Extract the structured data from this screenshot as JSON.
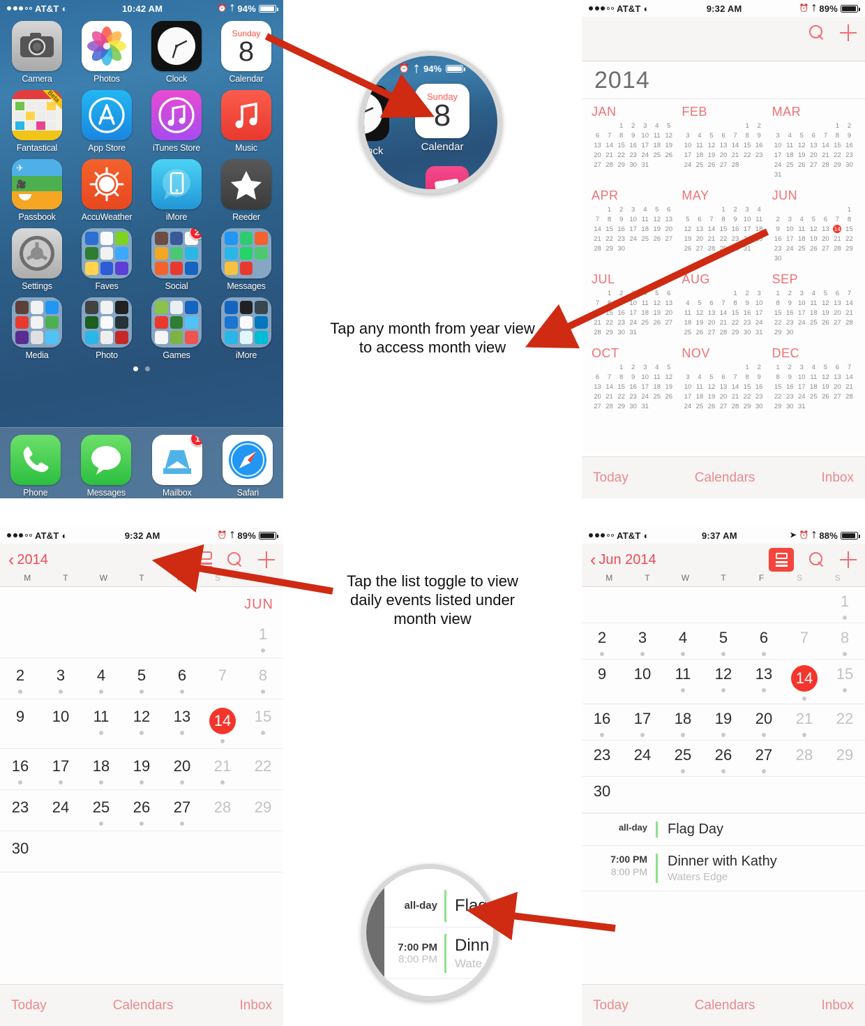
{
  "homescreen": {
    "status": {
      "carrier": "AT&T",
      "time": "10:42 AM",
      "battery": "94%",
      "signal_dots": [
        1,
        1,
        1,
        0,
        0
      ]
    },
    "rows": [
      [
        {
          "label": "Camera",
          "icon": "camera-icon"
        },
        {
          "label": "Photos",
          "icon": "photos-icon"
        },
        {
          "label": "Clock",
          "icon": "clock-icon"
        },
        {
          "label": "Calendar",
          "icon": "calendar-icon",
          "weekday": "Sunday",
          "day": "8"
        }
      ],
      [
        {
          "label": "Fantastical",
          "icon": "fantastical-icon",
          "ribbon": "Beta"
        },
        {
          "label": "App Store",
          "icon": "app-store-icon"
        },
        {
          "label": "iTunes Store",
          "icon": "itunes-store-icon"
        },
        {
          "label": "Music",
          "icon": "music-icon"
        }
      ],
      [
        {
          "label": "Passbook",
          "icon": "passbook-icon"
        },
        {
          "label": "AccuWeather",
          "icon": "accuweather-icon"
        },
        {
          "label": "iMore",
          "icon": "imore-icon"
        },
        {
          "label": "Reeder",
          "icon": "reeder-icon"
        }
      ],
      [
        {
          "label": "Settings",
          "icon": "settings-gear-icon"
        },
        {
          "label": "Faves",
          "icon": "folder-icon"
        },
        {
          "label": "Social",
          "icon": "folder-icon",
          "badge": "2"
        },
        {
          "label": "Messages",
          "icon": "folder-icon"
        }
      ],
      [
        {
          "label": "Media",
          "icon": "folder-icon"
        },
        {
          "label": "Photo",
          "icon": "folder-icon"
        },
        {
          "label": "Games",
          "icon": "folder-icon"
        },
        {
          "label": "iMore",
          "icon": "folder-icon"
        }
      ]
    ],
    "dock": [
      {
        "label": "Phone",
        "icon": "phone-icon"
      },
      {
        "label": "Messages",
        "icon": "messages-icon"
      },
      {
        "label": "Mailbox",
        "icon": "mailbox-icon",
        "badge": "1"
      },
      {
        "label": "Safari",
        "icon": "safari-compass-icon"
      }
    ],
    "page_dots": 2,
    "active_page": 0
  },
  "magnifier_home": {
    "battery": "94%",
    "weekday": "Sunday",
    "day": "8",
    "calendar_label": "Calendar",
    "clock_label": "ock"
  },
  "yearview": {
    "status": {
      "carrier": "AT&T",
      "time": "9:32 AM",
      "battery": "89%",
      "signal_dots": [
        1,
        1,
        1,
        0,
        0
      ]
    },
    "search_icon": "search-icon",
    "add_icon": "plus-icon",
    "year": "2014",
    "months": [
      {
        "name": "JAN",
        "lead": 2,
        "days": 31,
        "mark": 0
      },
      {
        "name": "FEB",
        "lead": 5,
        "days": 28,
        "mark": 0
      },
      {
        "name": "MAR",
        "lead": 5,
        "days": 31,
        "mark": 0
      },
      {
        "name": "APR",
        "lead": 1,
        "days": 30,
        "mark": 0
      },
      {
        "name": "MAY",
        "lead": 3,
        "days": 31,
        "mark": 0
      },
      {
        "name": "JUN",
        "lead": 6,
        "days": 30,
        "mark": 14
      },
      {
        "name": "JUL",
        "lead": 1,
        "days": 31,
        "mark": 0
      },
      {
        "name": "AUG",
        "lead": 4,
        "days": 31,
        "mark": 0
      },
      {
        "name": "SEP",
        "lead": 0,
        "days": 30,
        "mark": 0
      },
      {
        "name": "OCT",
        "lead": 2,
        "days": 31,
        "mark": 0
      },
      {
        "name": "NOV",
        "lead": 5,
        "days": 30,
        "mark": 0
      },
      {
        "name": "DEC",
        "lead": 0,
        "days": 31,
        "mark": 0
      }
    ],
    "toolbar": {
      "today": "Today",
      "calendars": "Calendars",
      "inbox": "Inbox"
    }
  },
  "monthview": {
    "status": {
      "carrier": "AT&T",
      "time": "9:32 AM",
      "battery": "89%",
      "signal_dots": [
        1,
        1,
        1,
        0,
        0
      ]
    },
    "back_label": "2014",
    "list_toggle_icon": "list-toggle-icon",
    "list_toggle_active": false,
    "search_icon": "search-icon",
    "add_icon": "plus-icon",
    "weekdays": [
      "M",
      "T",
      "W",
      "T",
      "F",
      "S",
      "S"
    ],
    "month_label": "JUN",
    "weeks": [
      [
        {
          "n": "",
          "dot": false
        },
        {
          "n": "",
          "dot": false
        },
        {
          "n": "",
          "dot": false
        },
        {
          "n": "",
          "dot": false
        },
        {
          "n": "",
          "dot": false
        },
        {
          "n": "",
          "dot": false
        },
        {
          "n": "1",
          "dot": true,
          "we": true
        }
      ],
      [
        {
          "n": "2",
          "dot": true
        },
        {
          "n": "3",
          "dot": true
        },
        {
          "n": "4",
          "dot": true
        },
        {
          "n": "5",
          "dot": true
        },
        {
          "n": "6",
          "dot": true
        },
        {
          "n": "7",
          "dot": false,
          "we": true
        },
        {
          "n": "8",
          "dot": true,
          "we": true
        }
      ],
      [
        {
          "n": "9",
          "dot": false
        },
        {
          "n": "10",
          "dot": false
        },
        {
          "n": "11",
          "dot": true
        },
        {
          "n": "12",
          "dot": true
        },
        {
          "n": "13",
          "dot": true
        },
        {
          "n": "14",
          "dot": true,
          "today": true
        },
        {
          "n": "15",
          "dot": true,
          "we": true
        }
      ],
      [
        {
          "n": "16",
          "dot": true
        },
        {
          "n": "17",
          "dot": true
        },
        {
          "n": "18",
          "dot": true
        },
        {
          "n": "19",
          "dot": true
        },
        {
          "n": "20",
          "dot": true
        },
        {
          "n": "21",
          "dot": true,
          "we": true
        },
        {
          "n": "22",
          "dot": false,
          "we": true
        }
      ],
      [
        {
          "n": "23",
          "dot": false
        },
        {
          "n": "24",
          "dot": false
        },
        {
          "n": "25",
          "dot": true
        },
        {
          "n": "26",
          "dot": true
        },
        {
          "n": "27",
          "dot": true
        },
        {
          "n": "28",
          "dot": false,
          "we": true
        },
        {
          "n": "29",
          "dot": false,
          "we": true
        }
      ],
      [
        {
          "n": "30",
          "dot": false
        },
        {
          "n": "",
          "dot": false
        },
        {
          "n": "",
          "dot": false
        },
        {
          "n": "",
          "dot": false
        },
        {
          "n": "",
          "dot": false
        },
        {
          "n": "",
          "dot": false
        },
        {
          "n": "",
          "dot": false
        }
      ]
    ],
    "toolbar": {
      "today": "Today",
      "calendars": "Calendars",
      "inbox": "Inbox"
    }
  },
  "monthlistview": {
    "status": {
      "carrier": "AT&T",
      "time": "9:37 AM",
      "battery": "88%",
      "signal_dots": [
        1,
        1,
        1,
        0,
        0
      ]
    },
    "back_label": "Jun 2014",
    "list_toggle_icon": "list-toggle-icon",
    "list_toggle_active": true,
    "search_icon": "search-icon",
    "add_icon": "plus-icon",
    "location_icon": "location-arrow-icon",
    "weekdays": [
      "M",
      "T",
      "W",
      "T",
      "F",
      "S",
      "S"
    ],
    "weeks": [
      [
        {
          "n": "",
          "dot": false
        },
        {
          "n": "",
          "dot": false
        },
        {
          "n": "",
          "dot": false
        },
        {
          "n": "",
          "dot": false
        },
        {
          "n": "",
          "dot": false
        },
        {
          "n": "",
          "dot": false
        },
        {
          "n": "1",
          "dot": true,
          "we": true
        }
      ],
      [
        {
          "n": "2",
          "dot": true
        },
        {
          "n": "3",
          "dot": true
        },
        {
          "n": "4",
          "dot": true
        },
        {
          "n": "5",
          "dot": true
        },
        {
          "n": "6",
          "dot": true
        },
        {
          "n": "7",
          "dot": false,
          "we": true
        },
        {
          "n": "8",
          "dot": true,
          "we": true
        }
      ],
      [
        {
          "n": "9",
          "dot": false
        },
        {
          "n": "10",
          "dot": false
        },
        {
          "n": "11",
          "dot": true
        },
        {
          "n": "12",
          "dot": true
        },
        {
          "n": "13",
          "dot": true
        },
        {
          "n": "14",
          "dot": true,
          "today": true
        },
        {
          "n": "15",
          "dot": true,
          "we": true
        }
      ],
      [
        {
          "n": "16",
          "dot": true
        },
        {
          "n": "17",
          "dot": true
        },
        {
          "n": "18",
          "dot": true
        },
        {
          "n": "19",
          "dot": true
        },
        {
          "n": "20",
          "dot": true
        },
        {
          "n": "21",
          "dot": true,
          "we": true
        },
        {
          "n": "22",
          "dot": false,
          "we": true
        }
      ],
      [
        {
          "n": "23",
          "dot": false
        },
        {
          "n": "24",
          "dot": false
        },
        {
          "n": "25",
          "dot": true
        },
        {
          "n": "26",
          "dot": true
        },
        {
          "n": "27",
          "dot": true
        },
        {
          "n": "28",
          "dot": false,
          "we": true
        },
        {
          "n": "29",
          "dot": false,
          "we": true
        }
      ],
      [
        {
          "n": "30",
          "dot": false
        },
        {
          "n": "",
          "dot": false
        },
        {
          "n": "",
          "dot": false
        },
        {
          "n": "",
          "dot": false
        },
        {
          "n": "",
          "dot": false
        },
        {
          "n": "",
          "dot": false
        },
        {
          "n": "",
          "dot": false
        }
      ]
    ],
    "events": [
      {
        "time_top": "all-day",
        "time_bottom": "",
        "title": "Flag Day",
        "location": "",
        "color": "#8fe08b"
      },
      {
        "time_top": "7:00 PM",
        "time_bottom": "8:00 PM",
        "title": "Dinner with Kathy",
        "location": "Waters Edge",
        "color": "#8fe08b"
      }
    ],
    "toolbar": {
      "today": "Today",
      "calendars": "Calendars",
      "inbox": "Inbox"
    }
  },
  "magnifier_events": {
    "e1_time": "all-day",
    "e1_title": "Flag",
    "e2_time_top": "7:00 PM",
    "e2_time_bottom": "8:00 PM",
    "e2_title": "Dinn",
    "e2_location": "Wate"
  },
  "annotations": {
    "note1_line1": "Tap any month from year view",
    "note1_line2": "to access month view",
    "note2_line1": "Tap the list toggle to view",
    "note2_line2": "daily events listed under",
    "note2_line3": "month view"
  },
  "colors": {
    "accent_red": "#f4352c",
    "tint_red": "#ee4b52",
    "arrow_red": "#cf2a12",
    "event_green": "#8fe08b"
  }
}
